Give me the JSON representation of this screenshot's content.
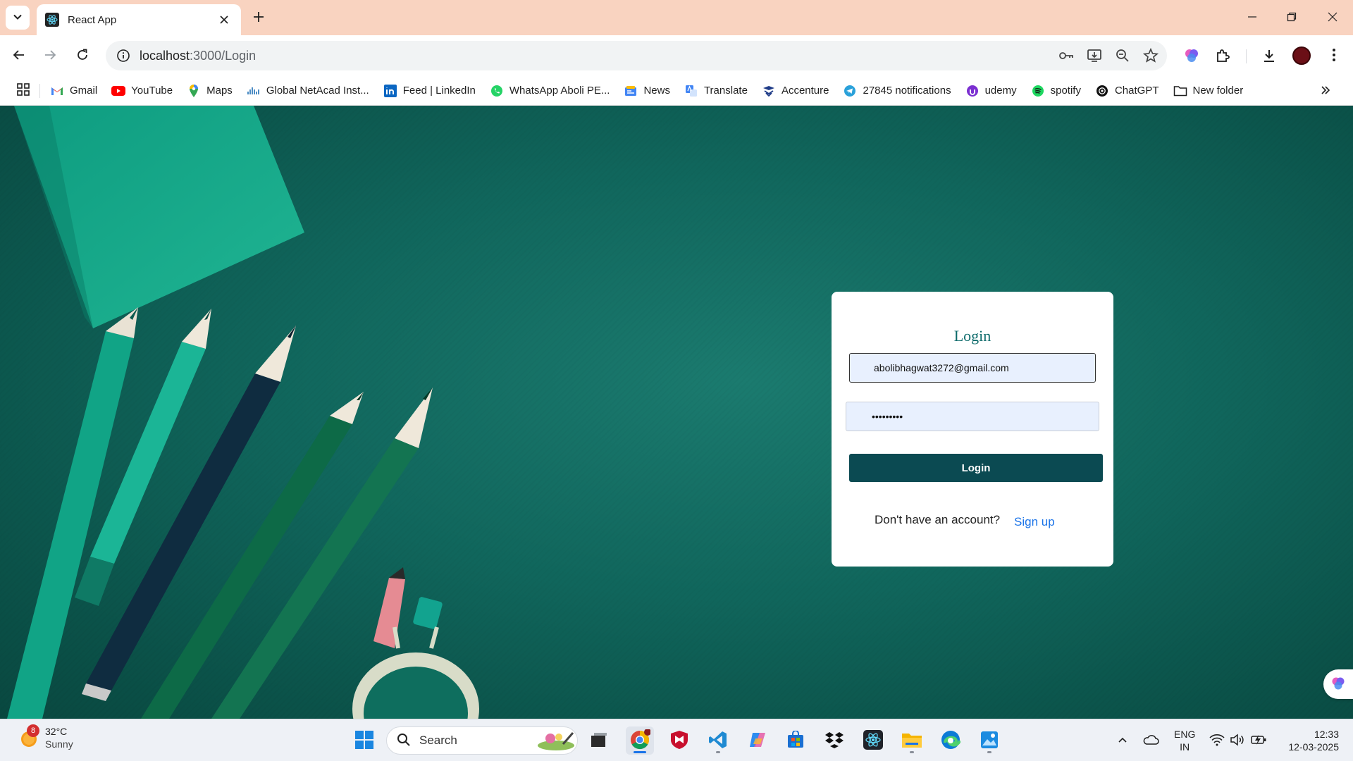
{
  "browser": {
    "tab_title": "React App",
    "url_host": "localhost",
    "url_path": ":3000/Login",
    "bookmarks": [
      {
        "label": "Gmail",
        "icon": "gmail-icon"
      },
      {
        "label": "YouTube",
        "icon": "youtube-icon"
      },
      {
        "label": "Maps",
        "icon": "maps-icon"
      },
      {
        "label": "Global NetAcad Inst...",
        "icon": "netacad-icon"
      },
      {
        "label": "Feed | LinkedIn",
        "icon": "linkedin-icon"
      },
      {
        "label": "WhatsApp Aboli PE...",
        "icon": "whatsapp-icon"
      },
      {
        "label": "News",
        "icon": "news-icon"
      },
      {
        "label": "Translate",
        "icon": "translate-icon"
      },
      {
        "label": "Accenture",
        "icon": "accenture-icon"
      },
      {
        "label": "27845 notifications",
        "icon": "telegram-icon"
      },
      {
        "label": "udemy",
        "icon": "udemy-icon"
      },
      {
        "label": "spotify",
        "icon": "spotify-icon"
      },
      {
        "label": "ChatGPT",
        "icon": "chatgpt-icon"
      },
      {
        "label": "New folder",
        "icon": "folder-icon"
      }
    ]
  },
  "login": {
    "title": "Login",
    "email_value": "abolibhagwat3272@gmail.com",
    "password_value": "•••••••••",
    "button_label": "Login",
    "signup_prompt": "Don't have an account?",
    "signup_link": "Sign up"
  },
  "taskbar": {
    "weather_badge": "8",
    "weather_temp": "32°C",
    "weather_condition": "Sunny",
    "search_placeholder": "Search",
    "language_line1": "ENG",
    "language_line2": "IN",
    "time": "12:33",
    "date": "12-03-2025"
  },
  "colors": {
    "tabstrip": "#f9d3c0",
    "page_background": "#10665c",
    "login_button": "#0b4a52",
    "login_title": "#0d6b6b",
    "link": "#1a73e8"
  }
}
